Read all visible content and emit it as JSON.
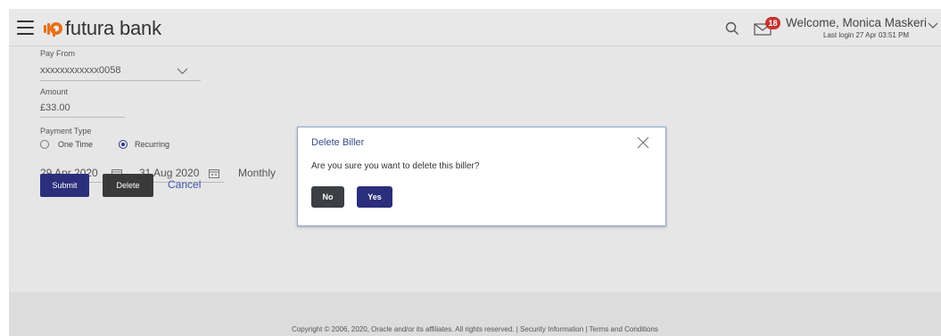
{
  "header": {
    "logo_text": "futura bank",
    "notifications_count": "18",
    "welcome_text": "Welcome, Monica Maskeri",
    "last_login": "Last login 27 Apr 03:51 PM"
  },
  "form": {
    "pay_from_label": "Pay From",
    "pay_from_value": "xxxxxxxxxxxx0058",
    "amount_label": "Amount",
    "amount_value": "£33.00",
    "payment_type_label": "Payment Type",
    "payment_type_options": [
      "One Time",
      "Recurring"
    ],
    "payment_type_selected": "Recurring",
    "start_date": "29 Apr 2020",
    "end_date": "31 Aug 2020",
    "frequency": "Monthly",
    "submit_label": "Submit",
    "delete_label": "Delete",
    "cancel_label": "Cancel"
  },
  "modal": {
    "title": "Delete Biller",
    "message": "Are you sure you want to delete this biller?",
    "no_label": "No",
    "yes_label": "Yes"
  },
  "footer": {
    "copyright": "Copyright © 2006, 2020, Oracle and/or its affiliates. All rights reserved. | Security Information | Terms and Conditions"
  },
  "colors": {
    "primary": "#2b2e7a",
    "badge": "#c83232",
    "logo_orange": "#e8701a",
    "link": "#3b56a8"
  },
  "icons": [
    "hamburger-icon",
    "futura-logo-icon",
    "search-icon",
    "mail-icon",
    "chevron-down-icon",
    "calendar-icon",
    "close-icon"
  ]
}
